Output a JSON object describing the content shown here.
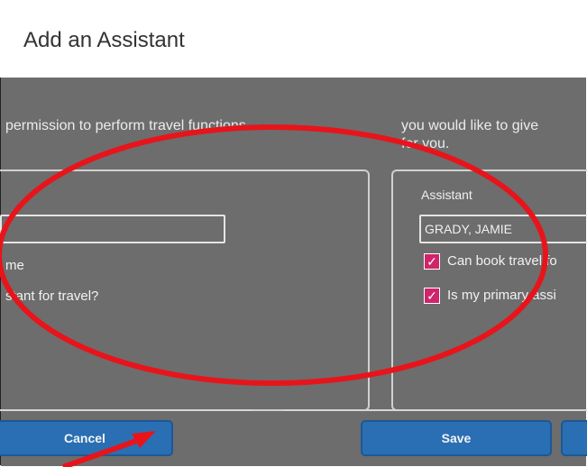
{
  "dialog": {
    "title": "Add an Assistant",
    "intro_line1_left": "",
    "intro_line1_right": "",
    "intro_line2_left": "permission to perform travel functions.",
    "intro_line2_right": "you would like to give",
    "intro_line3_right": "for you."
  },
  "left_panel": {
    "name_input_value": "",
    "checkbox1_label": "me",
    "checkbox2_label": "stant for travel?",
    "note_line1": "",
    "note_line2": ""
  },
  "right_panel": {
    "assistant_label": "Assistant",
    "assistant_input_value": "GRADY, JAMIE",
    "can_book_label": "Can book travel fo",
    "primary_label": "Is my primary assi"
  },
  "buttons": {
    "cancel": "Cancel",
    "save": "Save"
  },
  "colors": {
    "overlay": "#6d6d6d",
    "button": "#2a6fb4",
    "checkbox": "#d0246b",
    "annotation": "#e8141b"
  }
}
